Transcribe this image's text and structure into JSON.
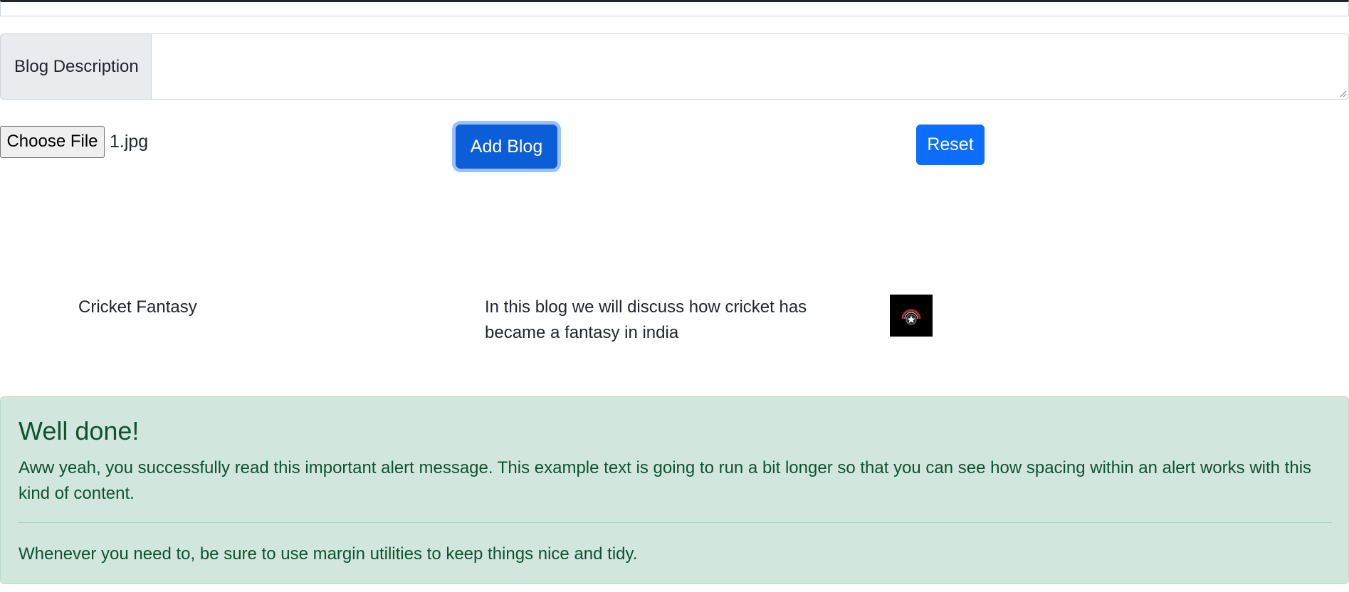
{
  "form": {
    "description_label": "Blog Description",
    "description_value": "",
    "choose_file_label": "Choose File",
    "file_name": "1.jpg",
    "add_button_label": "Add Blog",
    "reset_button_label": "Reset"
  },
  "blogs": [
    {
      "title": "Cricket Fantasy",
      "description": "In this blog we will discuss how cricket has became a fantasy in india",
      "thumbnail_icon": "star-emblem-icon"
    }
  ],
  "alert": {
    "heading": "Well done!",
    "body": "Aww yeah, you successfully read this important alert message. This example text is going to run a bit longer so that you can see how spacing within an alert works with this kind of content.",
    "footer": "Whenever you need to, be sure to use margin utilities to keep things nice and tidy."
  },
  "colors": {
    "primary": "#0d6efd",
    "primary_active": "#0b5ed7",
    "alert_bg": "#d1e7dd",
    "alert_text": "#0f5132",
    "addon_bg": "#e9ecef"
  }
}
